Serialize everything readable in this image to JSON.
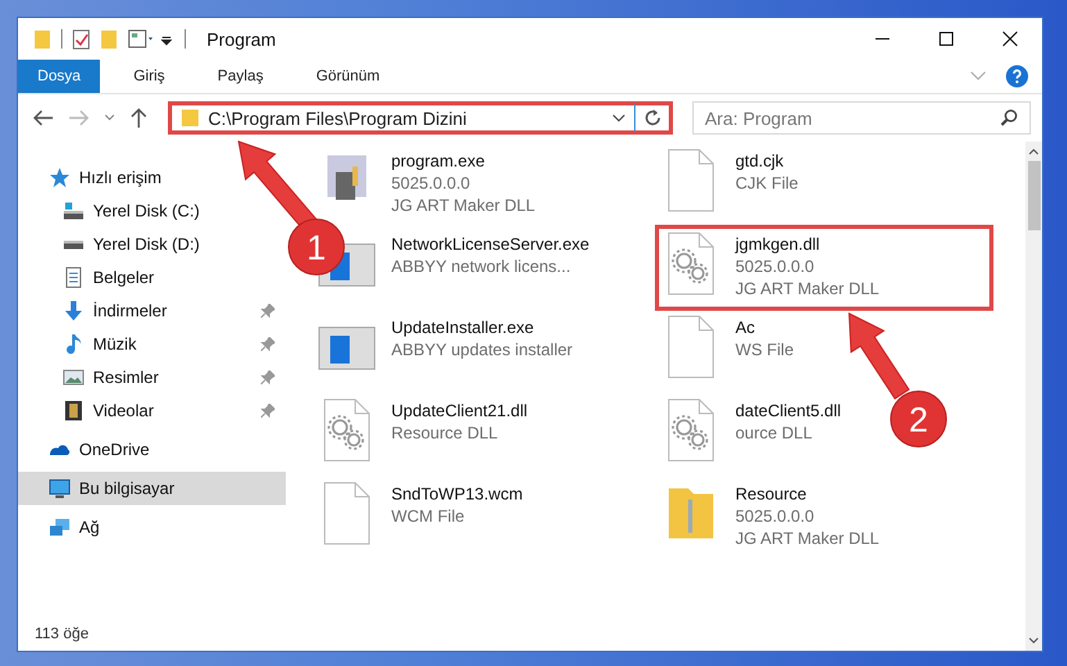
{
  "window": {
    "title": "Program"
  },
  "ribbon_tabs": [
    {
      "label": "Dosya",
      "selected": true
    },
    {
      "label": "Giriş",
      "selected": false
    },
    {
      "label": "Paylaş",
      "selected": false
    },
    {
      "label": "Görünüm",
      "selected": false
    }
  ],
  "address": {
    "path": "C:\\Program Files\\Program Dizini",
    "highlighted": true
  },
  "search": {
    "placeholder": "Ara: Program"
  },
  "sidebar": {
    "items": [
      {
        "label": "Hızlı erişim",
        "kind": "star",
        "selected": false,
        "children": [
          {
            "label": "Yerel Disk (C:)",
            "kind": "drive-c",
            "pinned": false,
            "selected": false
          },
          {
            "label": "Yerel Disk (D:)",
            "kind": "drive",
            "pinned": false,
            "selected": false
          },
          {
            "label": "Belgeler",
            "kind": "docs",
            "pinned": false,
            "selected": false
          },
          {
            "label": "İndirmeler",
            "kind": "download",
            "pinned": true,
            "selected": false
          },
          {
            "label": "Müzik",
            "kind": "music",
            "pinned": true,
            "selected": false
          },
          {
            "label": "Resimler",
            "kind": "pictures",
            "pinned": true,
            "selected": false
          },
          {
            "label": "Videolar",
            "kind": "videos",
            "pinned": true,
            "selected": false
          }
        ]
      },
      {
        "label": "OneDrive",
        "kind": "cloud",
        "selected": false
      },
      {
        "label": "Bu bilgisayar",
        "kind": "pc",
        "selected": true
      },
      {
        "label": "Ağ",
        "kind": "network",
        "selected": false
      }
    ]
  },
  "files": [
    {
      "name": "program.exe",
      "details": [
        "5025.0.0.0",
        "JG ART Maker DLL"
      ],
      "kind": "app",
      "highlighted": false
    },
    {
      "name": "gtd.cjk",
      "details": [
        "CJK File"
      ],
      "kind": "file",
      "highlighted": false
    },
    {
      "name": "NetworkLicenseServer.exe",
      "details": [
        "ABBYY network licens..."
      ],
      "kind": "window",
      "highlighted": false
    },
    {
      "name": "jgmkgen.dll",
      "details": [
        "5025.0.0.0",
        "JG ART Maker DLL"
      ],
      "kind": "dll",
      "highlighted": true
    },
    {
      "name": "UpdateInstaller.exe",
      "details": [
        "ABBYY updates installer"
      ],
      "kind": "window",
      "highlighted": false
    },
    {
      "name": "Ac",
      "details": [
        "WS File"
      ],
      "kind": "file",
      "highlighted": false
    },
    {
      "name": "UpdateClient21.dll",
      "details": [
        "Resource DLL"
      ],
      "kind": "dll",
      "highlighted": false
    },
    {
      "name": "dateClient5.dll",
      "details": [
        "ource DLL"
      ],
      "kind": "dll",
      "highlighted": false
    },
    {
      "name": "SndToWP13.wcm",
      "details": [
        "WCM File"
      ],
      "kind": "file",
      "highlighted": false
    },
    {
      "name": "Resource",
      "details": [
        "5025.0.0.0",
        "JG ART Maker DLL"
      ],
      "kind": "folder",
      "highlighted": false
    }
  ],
  "status_bar": {
    "count": "113 öğe"
  },
  "annotations": [
    {
      "number": "1"
    },
    {
      "number": "2"
    }
  ]
}
